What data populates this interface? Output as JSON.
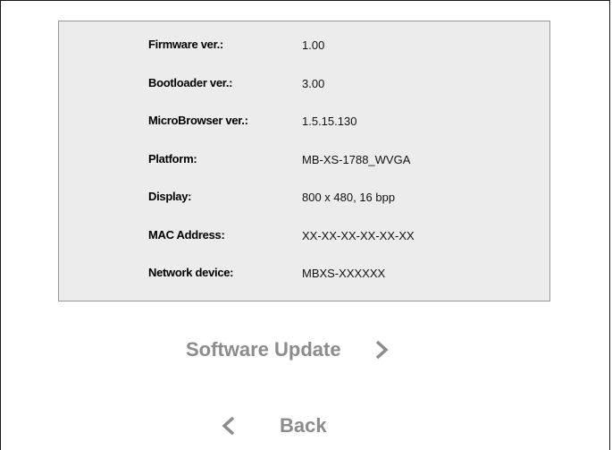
{
  "device_info": {
    "rows": [
      {
        "label": "Firmware ver.:",
        "value": "1.00"
      },
      {
        "label": "Bootloader ver.:",
        "value": "3.00"
      },
      {
        "label": "MicroBrowser ver.:",
        "value": "1.5.15.130"
      },
      {
        "label": "Platform:",
        "value": "MB-XS-1788_WVGA"
      },
      {
        "label": "Display:",
        "value": "800 x 480, 16 bpp"
      },
      {
        "label": "MAC Address:",
        "value": "XX-XX-XX-XX-XX-XX"
      },
      {
        "label": "Network device:",
        "value": "MBXS-XXXXXX"
      }
    ]
  },
  "actions": {
    "software_update_label": "Software Update",
    "back_label": "Back"
  },
  "icons": {
    "forward": "chevron-right-icon",
    "back": "chevron-left-icon"
  },
  "colors": {
    "panel_bg": "#ececec",
    "button_text": "#8c8c8c"
  }
}
